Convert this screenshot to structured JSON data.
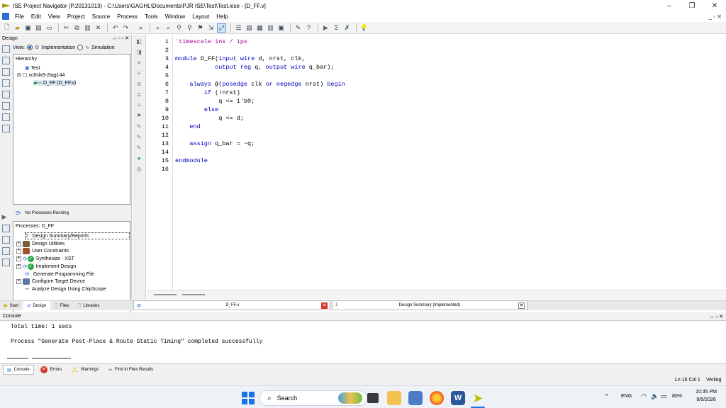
{
  "window": {
    "title": "ISE Project Navigator (P.20131013) - C:\\Users\\GAGHL\\Documents\\PJR ISE\\Test\\Test.xise - [D_FF.v]",
    "controls": {
      "minimize": "–",
      "restore": "❐",
      "close": "✕"
    }
  },
  "menu": {
    "items": [
      "File",
      "Edit",
      "View",
      "Project",
      "Source",
      "Process",
      "Tools",
      "Window",
      "Layout",
      "Help"
    ],
    "right_controls": "_ ▫ ✕"
  },
  "design_panel": {
    "header": "Design",
    "header_controls": "↔ ▫ ▫ ✕",
    "view_label": "View:",
    "view_implementation": "Implementation",
    "view_simulation": "Simulation",
    "hierarchy": {
      "title": "Hierarchy",
      "items": [
        "Test",
        "xc6slx9-2tqg144",
        "D_FF (D_FF.v)"
      ]
    },
    "process_status": "No Processes Running",
    "processes_title": "Processes: D_FF",
    "processes": [
      "Design Summary/Reports",
      "Design Utilities",
      "User Constraints",
      "Synthesize - XST",
      "Implement Design",
      "Generate Programming File",
      "Configure Target Device",
      "Analyze Design Using ChipScope"
    ]
  },
  "editor": {
    "line_numbers": [
      "1",
      "2",
      "3",
      "4",
      "5",
      "6",
      "7",
      "8",
      "9",
      "10",
      "11",
      "12",
      "13",
      "14",
      "15",
      "16"
    ],
    "lines": [
      "`timescale 1ns / 1ps",
      "",
      "module D_FF(input wire d, nrst, clk,",
      "           output reg q, output wire q_bar);",
      "",
      "    always @(posedge clk or negedge nrst) begin",
      "        if (!nrst)",
      "            q <= 1'b0;",
      "        else",
      "            q <= d;",
      "    end",
      "",
      "    assign q_bar = ~q;",
      "",
      "endmodule",
      ""
    ]
  },
  "bottom_tabs": {
    "start": "Start",
    "design": "Design",
    "files": "Files",
    "libraries": "Libraries",
    "editor_tab": "D_FF.v",
    "summary_tab": "Design Summary (Implemented)"
  },
  "console": {
    "header": "Console",
    "header_controls": "↔ ▫ ✕",
    "lines": [
      "Total time: 1 secs",
      "",
      "Process \"Generate Post-Place & Route Static Timing\" completed successfully"
    ],
    "tabs": [
      "Console",
      "Errors",
      "Warnings",
      "Find in Files Results"
    ]
  },
  "status": {
    "position": "Ln 16 Col 1",
    "language": "Verilog"
  },
  "taskbar": {
    "search": "Search",
    "lang": "ENG",
    "battery": "80%",
    "time": "10:35 PM",
    "date": "9/5/2026"
  },
  "colors": {
    "keyword": "#0000c0",
    "directive": "#a000a0",
    "check_green": "#2aa84a",
    "error_red": "#d9342b",
    "warning_yellow": "#e8b400"
  }
}
